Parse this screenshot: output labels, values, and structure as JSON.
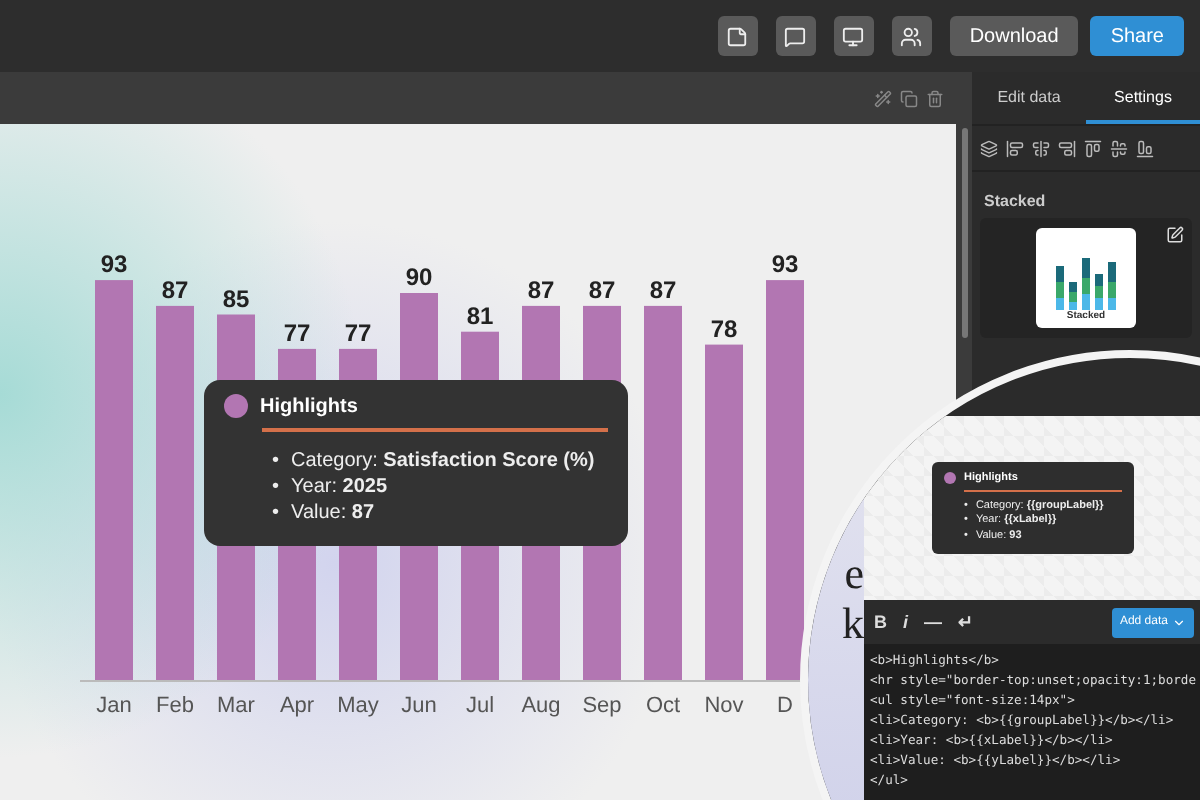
{
  "buttons": [
    {
      "label": "Download",
      "kind": "secondary"
    },
    {
      "label": "Share",
      "kind": "primary"
    }
  ],
  "panel": {
    "tabs": [
      {
        "label": "Edit data",
        "selected": false
      },
      {
        "label": "Settings",
        "selected": true
      }
    ],
    "section_label": "Stacked",
    "chart_type_label": "Stacked"
  },
  "chart": {
    "chart_data": {
      "type": "bar",
      "categories": [
        "Jan",
        "Feb",
        "Mar",
        "Apr",
        "May",
        "Jun",
        "Jul",
        "Aug",
        "Sep",
        "Oct",
        "Nov",
        "D"
      ],
      "series": [
        {
          "color": "#b276b2",
          "values": [
            93,
            87,
            85,
            77,
            77,
            90,
            81,
            87,
            87,
            87,
            78,
            93
          ]
        }
      ],
      "data_labels": true
    }
  },
  "tooltip": {
    "title": "Highlights",
    "items": [
      {
        "bullet": "•",
        "text": "Category: **Satisfaction Score (%)**"
      },
      {
        "bullet": "•",
        "text": "Year: **2025**"
      },
      {
        "bullet": "•",
        "text": "Value: **87**"
      }
    ]
  },
  "magnifier": {
    "background_text": [
      "e",
      "k"
    ],
    "preview_tooltip": {
      "title": "Highlights",
      "items": [
        {
          "bullet": "•",
          "text": "Category: **{{groupLabel}}**"
        },
        {
          "bullet": "•",
          "text": "Year: **{{xLabel}}**"
        },
        {
          "bullet": "•",
          "text": "Value: **93**"
        }
      ]
    },
    "editor_tools": [
      "B",
      "i",
      "—",
      "↵"
    ],
    "add_data": "Add data",
    "code_lines": [
      "<b>Highlights</b>",
      "<hr style=\"border-top:unset;opacity:1;borde",
      "<ul style=\"font-size:14px\">",
      "<li>Category: <b>{{groupLabel}}</b></li>",
      "<li>Year: <b>{{xLabel}}</b></li>",
      "<li>Value: <b>{{yLabel}}</b></li>",
      "</ul>"
    ]
  }
}
